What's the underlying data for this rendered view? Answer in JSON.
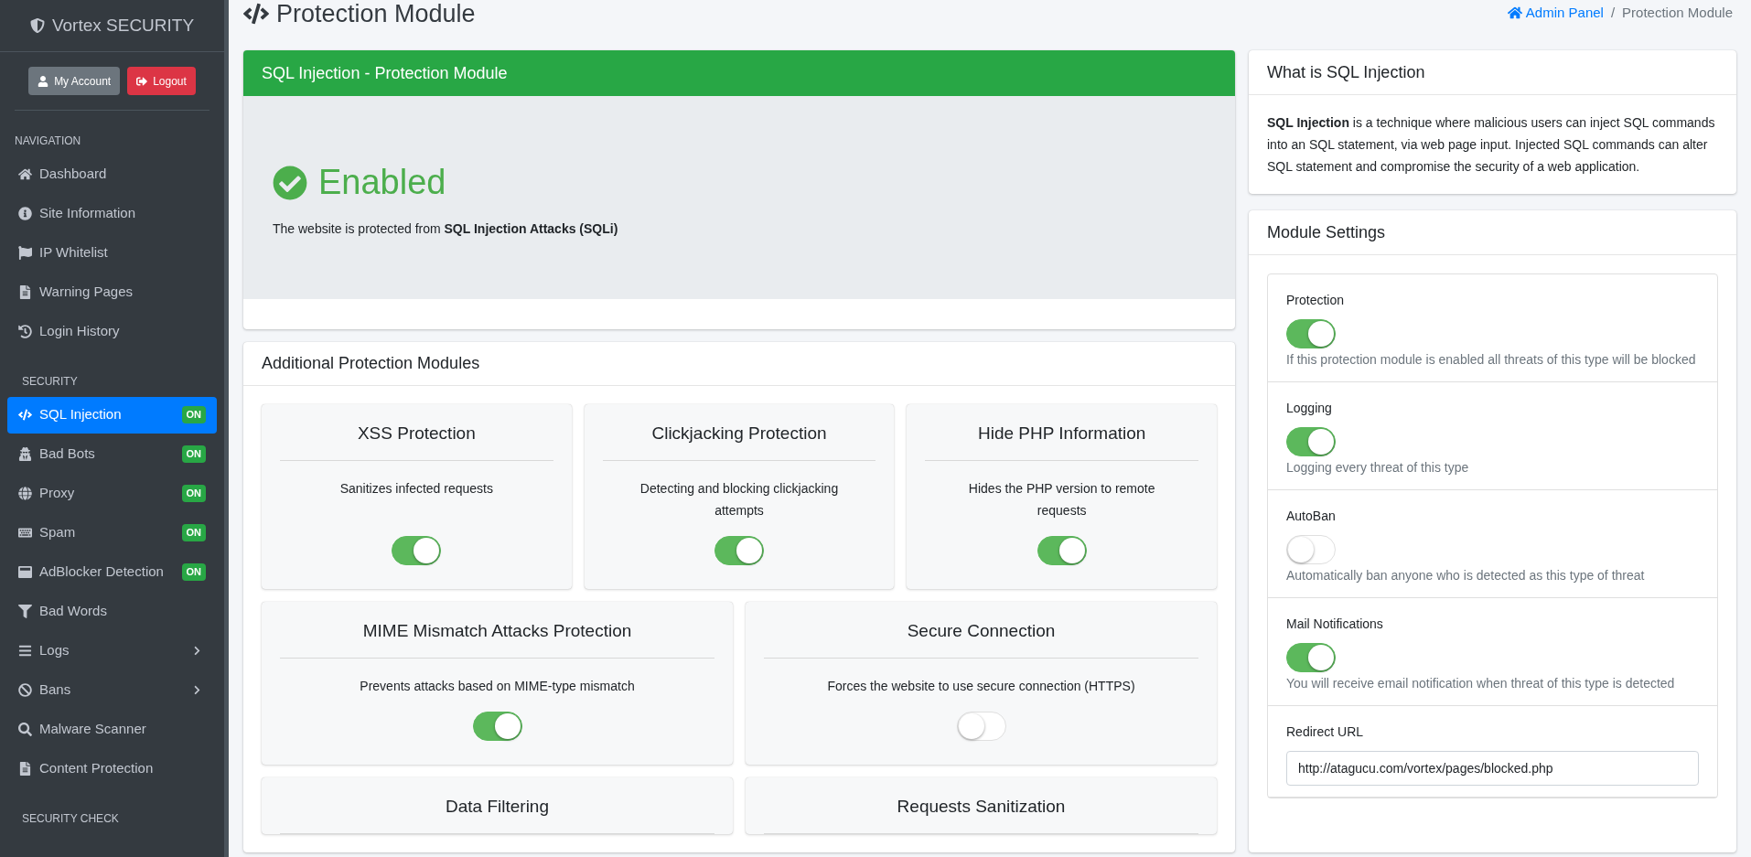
{
  "brand": {
    "title": "Vortex SECURITY"
  },
  "account_buttons": [
    {
      "label": "My Account",
      "kind": "account"
    },
    {
      "label": "Logout",
      "kind": "logout"
    }
  ],
  "sidebar": {
    "sections": [
      {
        "heading": "NAVIGATION",
        "items": [
          {
            "label": "Dashboard",
            "selected": false,
            "kind": "link"
          },
          {
            "label": "Site Information",
            "selected": false,
            "kind": "link"
          },
          {
            "label": "IP Whitelist",
            "selected": false,
            "kind": "link"
          },
          {
            "label": "Warning Pages",
            "selected": false,
            "kind": "link"
          },
          {
            "label": "Login History",
            "selected": false,
            "kind": "link"
          }
        ]
      },
      {
        "heading": "SECURITY",
        "items": [
          {
            "label": "SQL Injection",
            "selected": true,
            "kind": "link",
            "badge": "ON"
          },
          {
            "label": "Bad Bots",
            "selected": false,
            "kind": "link",
            "badge": "ON"
          },
          {
            "label": "Proxy",
            "selected": false,
            "kind": "link",
            "badge": "ON"
          },
          {
            "label": "Spam",
            "selected": false,
            "kind": "link",
            "badge": "ON"
          },
          {
            "label": "AdBlocker Detection",
            "selected": false,
            "kind": "link",
            "badge": "ON"
          },
          {
            "label": "Bad Words",
            "selected": false,
            "kind": "link"
          },
          {
            "label": "Logs",
            "selected": false,
            "kind": "group"
          },
          {
            "label": "Bans",
            "selected": false,
            "kind": "group"
          },
          {
            "label": "Malware Scanner",
            "selected": false,
            "kind": "link"
          },
          {
            "label": "Content Protection",
            "selected": false,
            "kind": "link"
          }
        ]
      },
      {
        "heading": "SECURITY CHECK"
      }
    ]
  },
  "page": {
    "title": "Protection Module",
    "breadcrumb_separator": "/",
    "breadcrumb": [
      {
        "label": "Admin Panel",
        "kind": "link"
      },
      {
        "label": "Protection Module",
        "kind": "current"
      }
    ]
  },
  "status_card": {
    "header": "SQL Injection - Protection Module",
    "status": "Enabled",
    "enabled": true,
    "message": "The website is protected from **SQL Injection Attacks (SQLi)**"
  },
  "additional_modules": {
    "title": "Additional Protection Modules",
    "rows": [
      [
        {
          "title": "XSS Protection",
          "description": "Sanitizes infected requests",
          "on": true
        },
        {
          "title": "Clickjacking Protection",
          "description": "Detecting and blocking clickjacking attempts",
          "on": true
        },
        {
          "title": "Hide PHP Information",
          "description": "Hides the PHP version to remote requests",
          "on": true
        }
      ],
      [
        {
          "title": "MIME Mismatch Attacks Protection",
          "description": "Prevents attacks based on MIME-type mismatch",
          "on": true
        },
        {
          "title": "Secure Connection",
          "description": "Forces the website to use secure connection (HTTPS)",
          "on": false
        }
      ],
      [
        {
          "title": "Data Filtering"
        },
        {
          "title": "Requests Sanitization"
        }
      ]
    ]
  },
  "info_card": {
    "title": "What is SQL Injection",
    "text": "**SQL Injection** is a technique where malicious users can inject SQL commands into an SQL statement, via web page input. Injected SQL commands can alter SQL statement and compromise the security of a web application."
  },
  "module_settings": {
    "title": "Module Settings",
    "settings": [
      {
        "kind": "toggle",
        "label": "Protection",
        "on": true,
        "help": "If this protection module is enabled all threats of this type will be blocked"
      },
      {
        "kind": "toggle",
        "label": "Logging",
        "on": true,
        "help": "Logging every threat of this type"
      },
      {
        "kind": "toggle",
        "label": "AutoBan",
        "on": false,
        "help": "Automatically ban anyone who is detected as this type of threat"
      },
      {
        "kind": "toggle",
        "label": "Mail Notifications",
        "on": true,
        "help": "You will receive email notification when threat of this type is detected"
      },
      {
        "kind": "text",
        "label": "Redirect URL",
        "value": "http://atagucu.com/vortex/pages/blocked.php"
      }
    ]
  }
}
